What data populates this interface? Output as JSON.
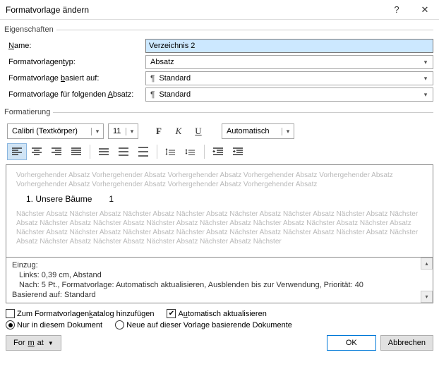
{
  "title": "Formatvorlage ändern",
  "group_props": "Eigenschaften",
  "labels": {
    "name_pre": "",
    "name_u": "N",
    "name_post": "ame:",
    "type": "Formatvorlagentyp:",
    "type_u": "t",
    "based_pre": "Formatvorlage ",
    "based_u": "b",
    "based_post": "asiert auf:",
    "next_pre": "Formatvorlage für folgenden ",
    "next_u": "A",
    "next_post": "bsatz:"
  },
  "values": {
    "name": "Verzeichnis 2",
    "type": "Absatz",
    "based": "Standard",
    "next": "Standard"
  },
  "group_fmt": "Formatierung",
  "font": "Calibri (Textkörper)",
  "size": "11",
  "btn_bold": "F",
  "btn_italic": "K",
  "btn_under": "U",
  "auto": "Automatisch",
  "preview": {
    "prev": "Vorhergehender Absatz Vorhergehender Absatz Vorhergehender Absatz Vorhergehender Absatz Vorhergehender Absatz Vorhergehender Absatz Vorhergehender Absatz Vorhergehender Absatz Vorhergehender Absatz",
    "sample": "1. Unsere Bäume  1",
    "next": "Nächster Absatz Nächster Absatz Nächster Absatz Nächster Absatz Nächster Absatz Nächster Absatz Nächster Absatz Nächster Absatz Nächster Absatz Nächster Absatz Nächster Absatz Nächster Absatz Nächster Absatz Nächster Absatz Nächster Absatz Nächster Absatz Nächster Absatz Nächster Absatz Nächster Absatz Nächster Absatz Nächster Absatz Nächster Absatz Nächster Absatz Nächster Absatz Nächster Absatz Nächster Absatz Nächster Absatz Nächster"
  },
  "desc": {
    "head": "Einzug:",
    "l1": "Links:  0,39 cm, Abstand",
    "l2": "Nach:  5 Pt., Formatvorlage: Automatisch aktualisieren, Ausblenden bis zur Verwendung, Priorität: 40",
    "l3": "Basierend auf: Standard"
  },
  "chk": {
    "add_pre": "Zum Formatvorlagen",
    "add_u": "k",
    "add_post": "atalog hinzufügen",
    "auto_pre": "A",
    "auto_u": "u",
    "auto_post": "tomatisch aktualisieren",
    "only": "Nur in diesem Dokument",
    "new": "Neue auf dieser Vorlage basierende Dokumente"
  },
  "btns": {
    "format_pre": "For",
    "format_u": "m",
    "format_post": "at",
    "ok": "OK",
    "cancel": "Abbrechen"
  }
}
